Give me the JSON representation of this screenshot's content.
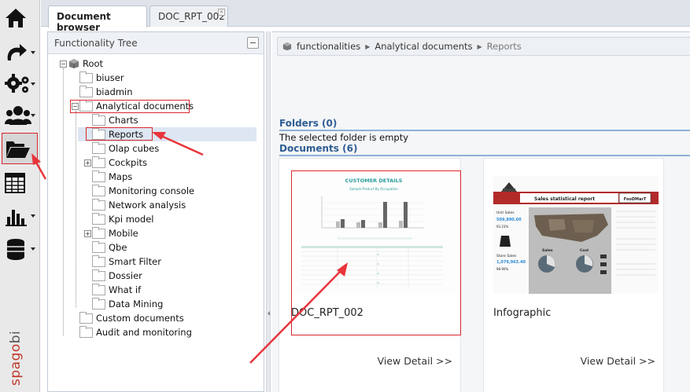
{
  "sidebar": {
    "items": [
      {
        "name": "home-icon",
        "caret": false
      },
      {
        "name": "redo-arrow-icon",
        "caret": true
      },
      {
        "name": "gears-icon",
        "caret": true
      },
      {
        "name": "users-icon",
        "caret": true
      },
      {
        "name": "folder-open-icon",
        "caret": false
      },
      {
        "name": "table-icon",
        "caret": false
      },
      {
        "name": "bar-chart-icon",
        "caret": true
      },
      {
        "name": "database-icon",
        "caret": true
      }
    ],
    "brand_part1": "spago",
    "brand_part2": "bi"
  },
  "tabs": [
    {
      "label": "Document browser",
      "active": true
    },
    {
      "label": "DOC_RPT_002",
      "active": false,
      "close": "×"
    }
  ],
  "tree": {
    "title": "Functionality Tree",
    "root": "Root",
    "nodes": [
      "biuser",
      "biadmin",
      "Analytical documents",
      "Charts",
      "Reports",
      "Olap cubes",
      "Cockpits",
      "Maps",
      "Monitoring console",
      "Network analysis",
      "Kpi model",
      "Mobile",
      "Qbe",
      "Smart Filter",
      "Dossier",
      "What if",
      "Data Mining",
      "Custom documents",
      "Audit and monitoring"
    ]
  },
  "breadcrumb": {
    "items": [
      "functionalities",
      "Analytical documents",
      "Reports"
    ]
  },
  "folders": {
    "header": "Folders (0)",
    "empty_text": "The selected folder is empty"
  },
  "documents": {
    "header": "Documents (6)",
    "cards": [
      {
        "title": "DOC_RPT_002",
        "detail": "View Detail >>",
        "thumb_title": "CUSTOMER DETAILS",
        "thumb_subtitle": "Sample Product By Occupation"
      },
      {
        "title": "Infographic",
        "detail": "View Detail >>",
        "thumb_title": "Sales statistical report",
        "thumb_brand": "FooDMarT",
        "unit_sales_label": "Unit Sales",
        "unit_sales_value": "509,890.00",
        "unit_pct": "93.23%",
        "store_sales_label": "Store Sales",
        "store_sales_value": "1,079,963.40",
        "store_pct": "98.90%",
        "sales_label": "Sales",
        "cost_label": "Cost"
      }
    ]
  },
  "colors": {
    "highlight_red": "#d9272e",
    "section_blue": "#2f5d92",
    "selected_row": "#dde6f2"
  }
}
